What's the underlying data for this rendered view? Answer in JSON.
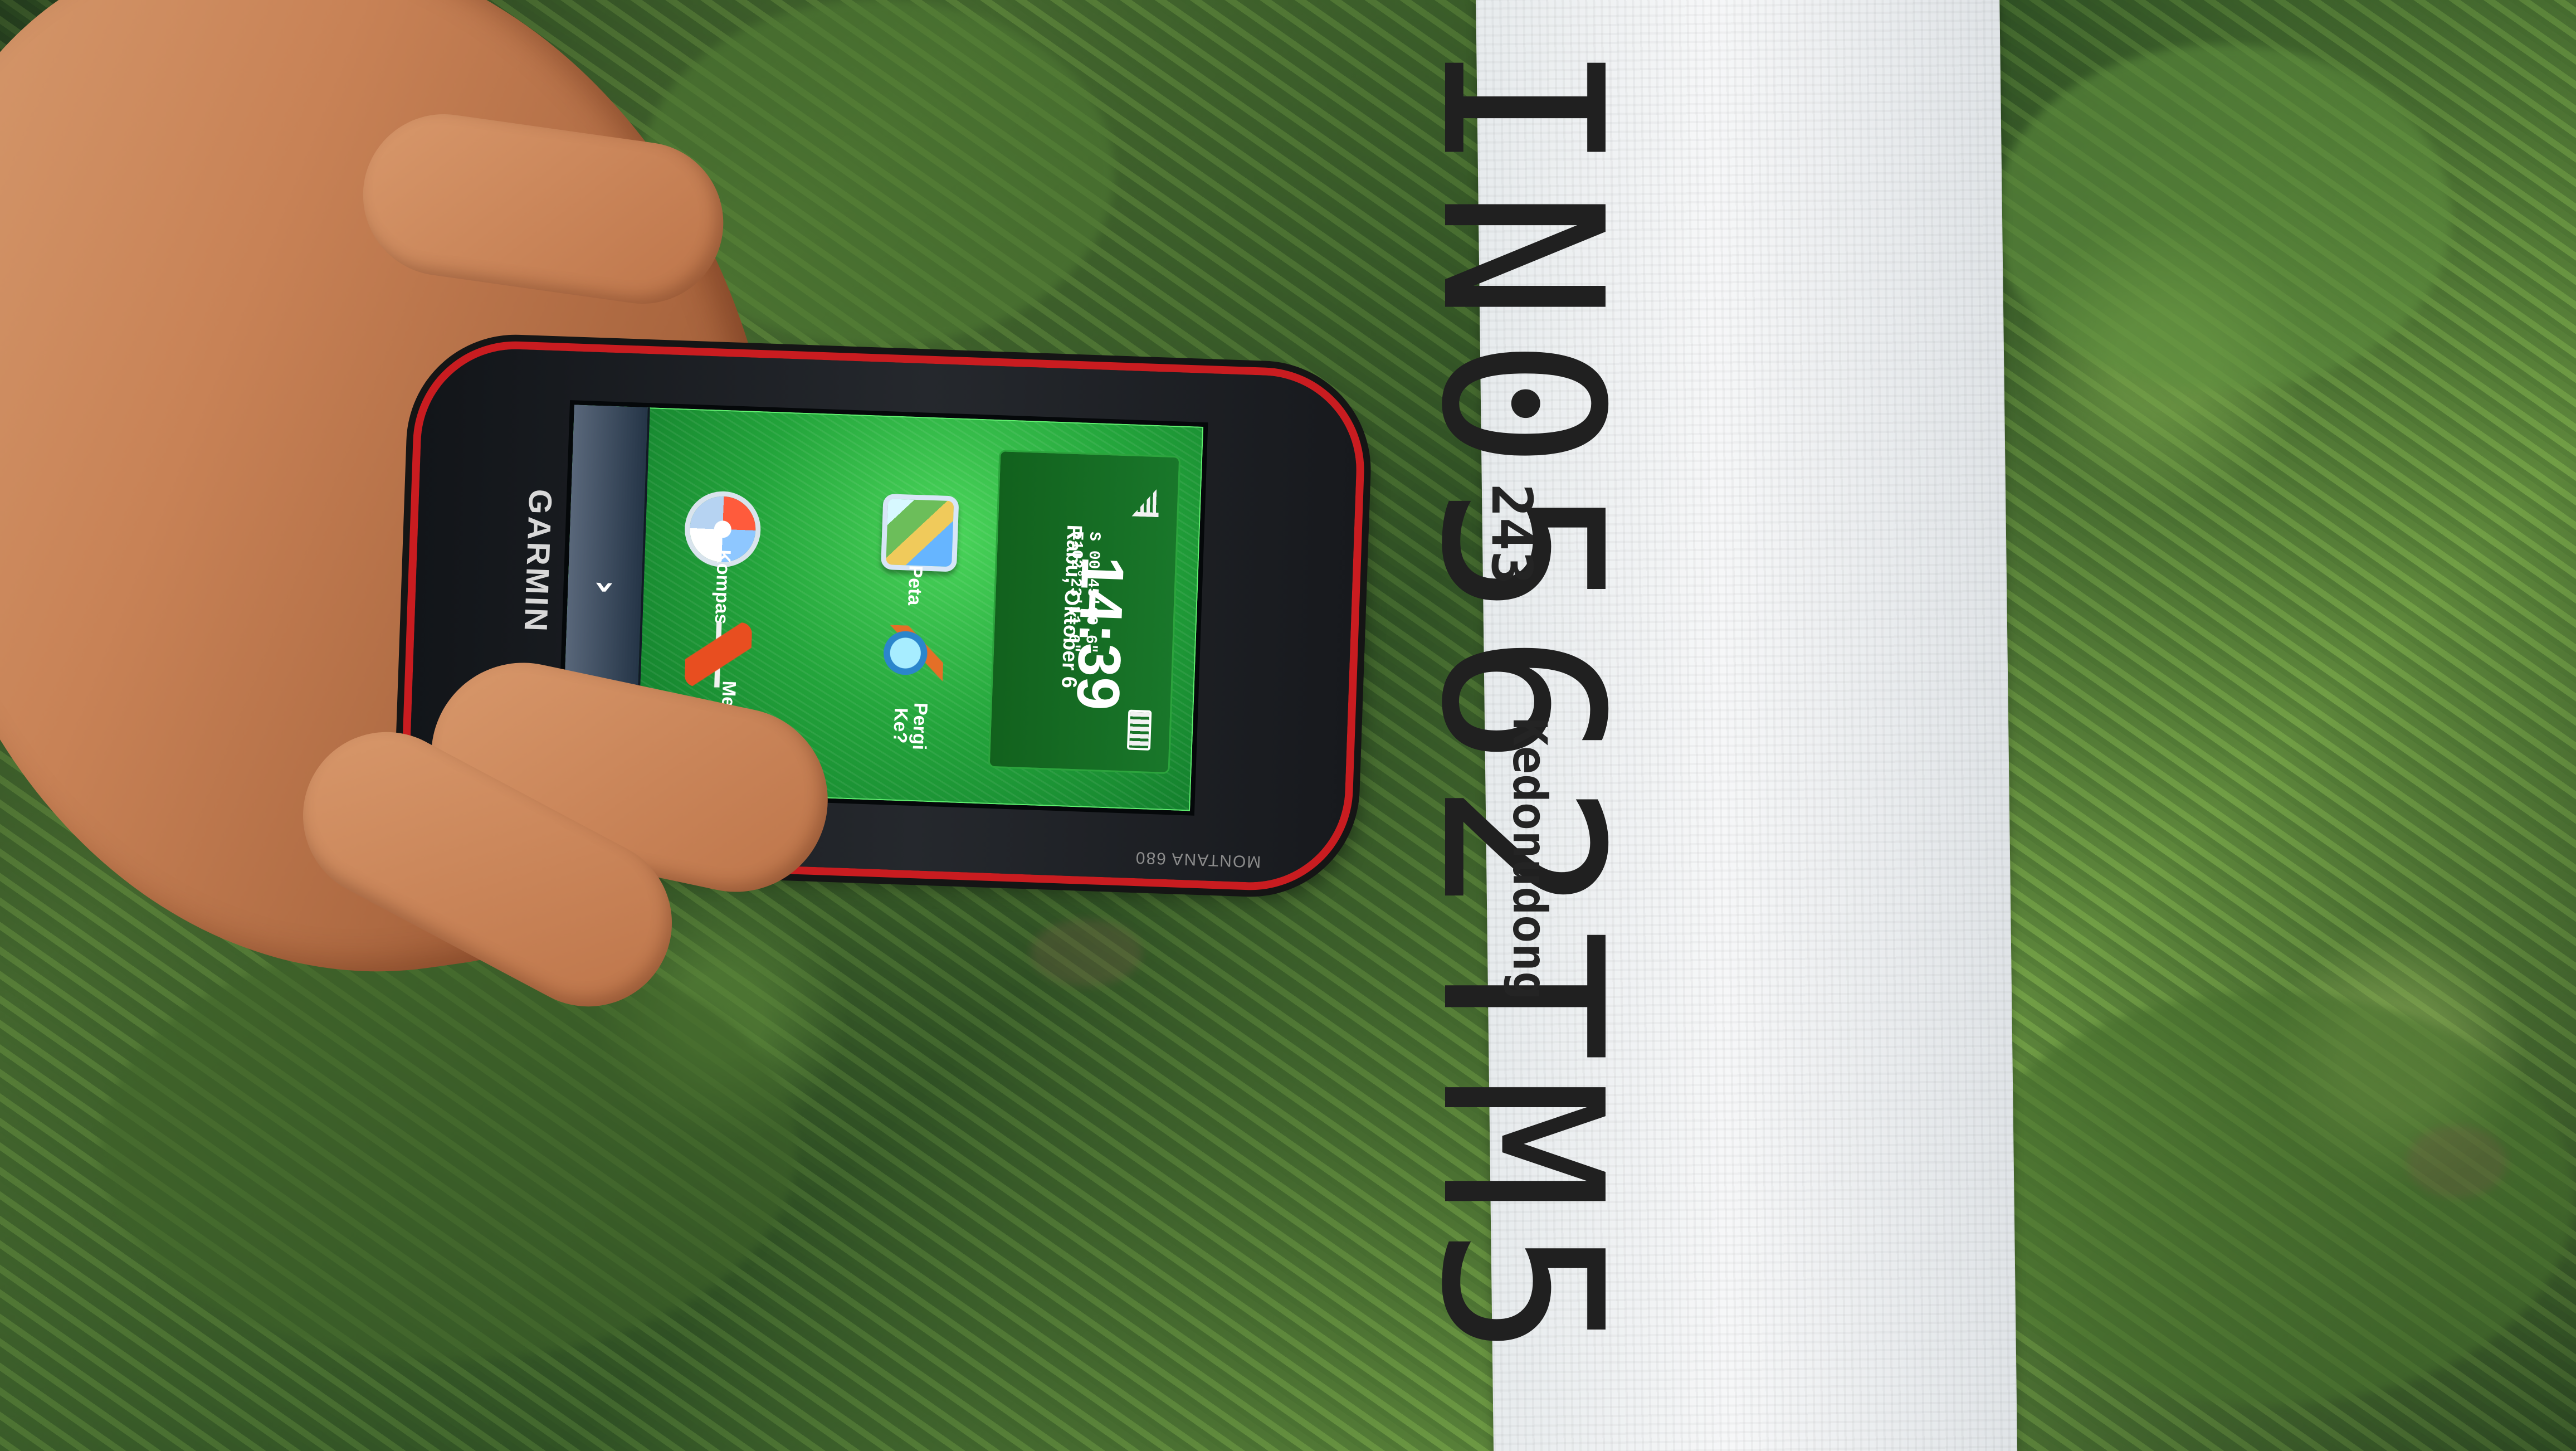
{
  "scene": {
    "description_label": "",
    "tag": {
      "main_code": "IN0562TM5",
      "small_number": "243",
      "small_word": "Kedonudong"
    },
    "device": {
      "brand": "GARMIN",
      "model": "MONTANA 680",
      "screen": {
        "coordinates": "S 00°45'09.6\"\nE102°23'11.6\"",
        "time": "14:39",
        "date": "Rabu, Oktober 6",
        "menu": [
          {
            "label": "Kompas",
            "icon": "compass-icon"
          },
          {
            "label": "Peta",
            "icon": "map-icon"
          },
          {
            "label": "Membuat Titik",
            "icon": "flag-icon"
          },
          {
            "label": "Pergi Ke?",
            "icon": "search-icon"
          }
        ],
        "nav_symbol": "›"
      }
    },
    "colors": {
      "moss": "#4f7534",
      "tape": "#f6f7f8",
      "device_red": "#c91c20",
      "screen_green": "#23a43b"
    }
  }
}
